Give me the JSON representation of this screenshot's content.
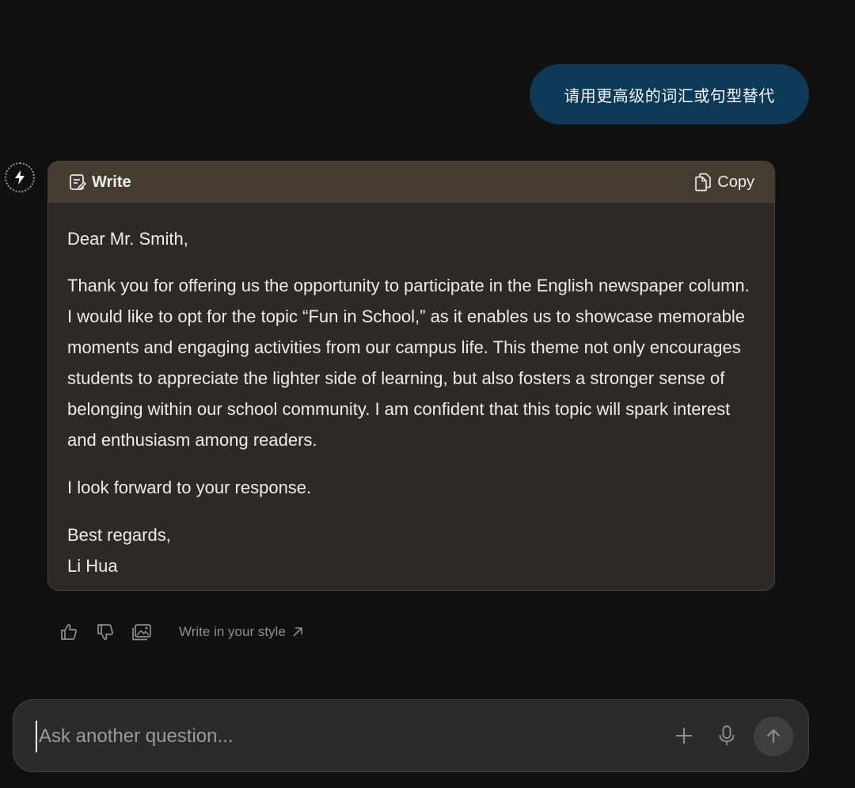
{
  "conversation": {
    "user_message": "请用更高级的词汇或句型替代"
  },
  "card": {
    "mode_icon": "write-icon",
    "mode_label": "Write",
    "copy_icon": "copy-icon",
    "copy_label": "Copy",
    "letter": {
      "greeting": "Dear Mr. Smith,",
      "body": "Thank you for offering us the opportunity to participate in the English newspaper column. I would like to opt for the topic “Fun in School,” as it enables us to showcase memorable moments and engaging activities from our campus life. This theme not only encourages students to appreciate the lighter side of learning, but also fosters a stronger sense of belonging within our school community. I am confident that this topic will spark interest and enthusiasm among readers.",
      "closing_line": "I look forward to your response.",
      "sign_off": "Best regards,",
      "signature": "Li Hua"
    }
  },
  "actions": {
    "icons": [
      "thumbs-up-icon",
      "thumbs-down-icon",
      "image-icon"
    ],
    "style_link_label": "Write in your style",
    "style_link_icon": "arrow-up-right-icon"
  },
  "input": {
    "placeholder": "Ask another question...",
    "value": "",
    "icons": [
      "plus-icon",
      "microphone-icon",
      "send-arrow-icon"
    ]
  },
  "colors": {
    "background": "#111111",
    "user_bubble": "#0e3a58",
    "card_body": "#2d2b27",
    "card_header": "#453d31",
    "input_bar": "#2b2b2b"
  }
}
